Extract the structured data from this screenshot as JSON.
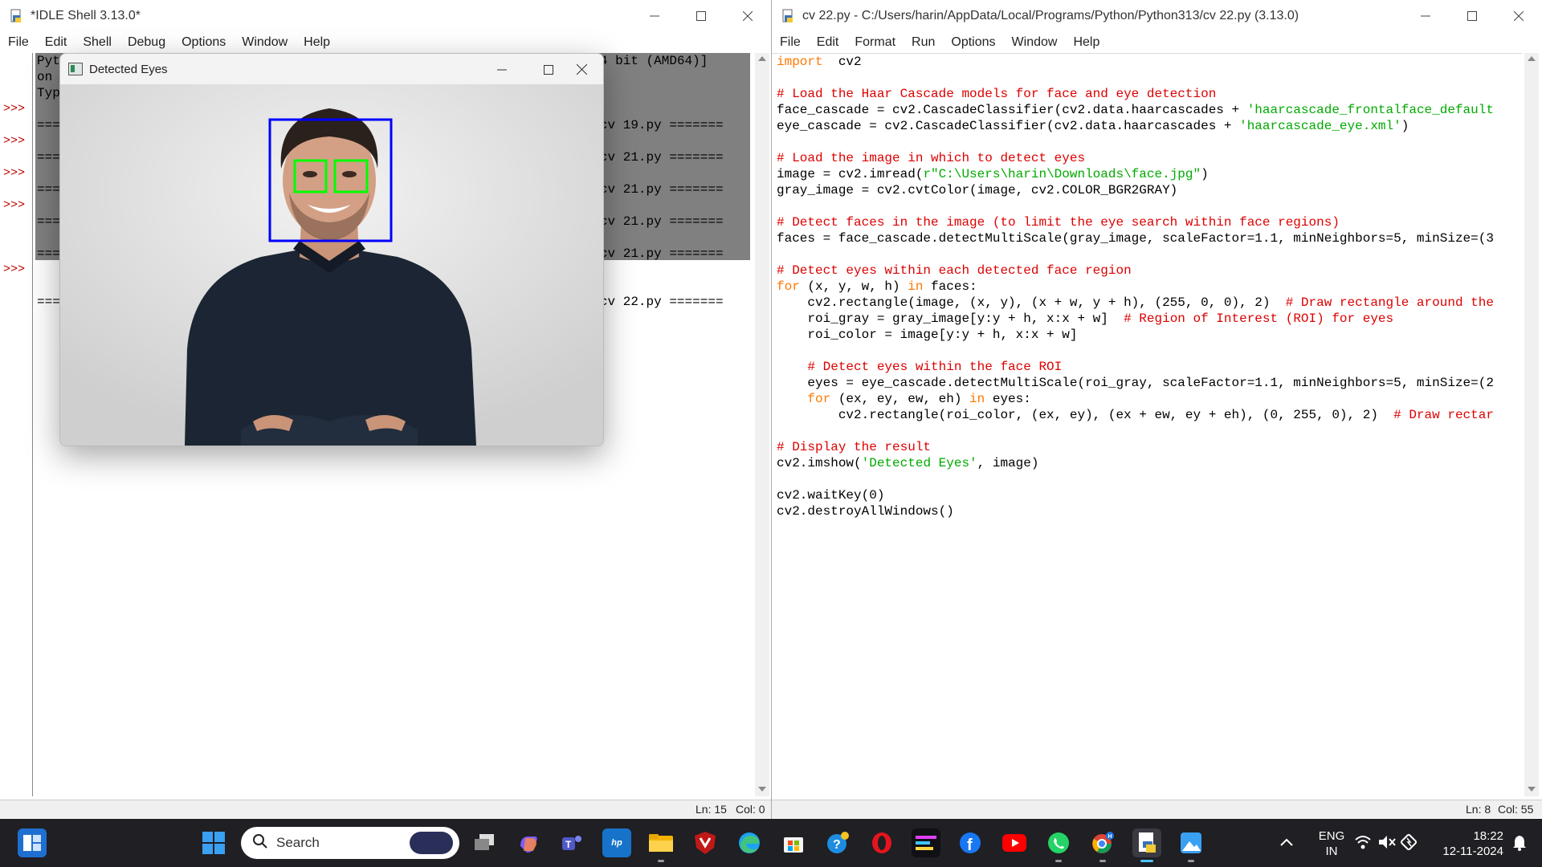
{
  "shell_window": {
    "title": "*IDLE Shell 3.13.0*",
    "menu": [
      "File",
      "Edit",
      "Shell",
      "Debug",
      "Options",
      "Window",
      "Help"
    ],
    "prompt": ">>>",
    "lines": [
      "Python 3.13.0 (tags/v3.13.0:60403a5, Oct  7 2024, 09:38:07) [MSC v.1941 64 bit (AMD64)]",
      "on win32",
      "Type \"help\", \"copyright\", \"credits\" or \"license()\" for more information.",
      "",
      "======== RESTART: C:/Users/harin/AppData/Local/Programs/Python/Python313/cv 19.py =======",
      "",
      "======== RESTART: C:/Users/harin/AppData/Local/Programs/Python/Python313/cv 21.py =======",
      "",
      "======== RESTART: C:/Users/harin/AppData/Local/Programs/Python/Python313/cv 21.py =======",
      "",
      "======== RESTART: C:/Users/harin/AppData/Local/Programs/Python/Python313/cv 21.py =======",
      "",
      "======== RESTART: C:/Users/harin/AppData/Local/Programs/Python/Python313/cv 21.py =======",
      "",
      "",
      "======== RESTART: C:/Users/harin/AppData/Local/Programs/Python/Python313/cv 22.py ======="
    ],
    "status": {
      "ln": "Ln: 15",
      "col": "Col: 0"
    }
  },
  "popup_window": {
    "title": "Detected Eyes"
  },
  "editor_window": {
    "title": "cv 22.py - C:/Users/harin/AppData/Local/Programs/Python/Python313/cv 22.py (3.13.0)",
    "menu": [
      "File",
      "Edit",
      "Format",
      "Run",
      "Options",
      "Window",
      "Help"
    ],
    "code": [
      [
        [
          "kw",
          "import"
        ],
        [
          "",
          "  cv2"
        ]
      ],
      [],
      [
        [
          "cm",
          "# Load the Haar Cascade models for face and eye detection"
        ]
      ],
      [
        [
          "",
          "face_cascade = cv2.CascadeClassifier(cv2.data.haarcascades + "
        ],
        [
          "st",
          "'haarcascade_frontalface_default"
        ]
      ],
      [
        [
          "",
          "eye_cascade = cv2.CascadeClassifier(cv2.data.haarcascades + "
        ],
        [
          "st",
          "'haarcascade_eye.xml'"
        ],
        [
          "",
          ")"
        ]
      ],
      [],
      [
        [
          "cm",
          "# Load the image in which to detect eyes"
        ]
      ],
      [
        [
          "",
          "image = cv2.imread("
        ],
        [
          "st",
          "r\"C:\\Users\\harin\\Downloads\\face.jpg\""
        ],
        [
          "",
          ")"
        ]
      ],
      [
        [
          "",
          "gray_image = cv2.cvtColor(image, cv2.COLOR_BGR2GRAY)"
        ]
      ],
      [],
      [
        [
          "cm",
          "# Detect faces in the image (to limit the eye search within face regions)"
        ]
      ],
      [
        [
          "",
          "faces = face_cascade.detectMultiScale(gray_image, scaleFactor=1.1, minNeighbors=5, minSize=(3"
        ]
      ],
      [],
      [
        [
          "cm",
          "# Detect eyes within each detected face region"
        ]
      ],
      [
        [
          "kw",
          "for"
        ],
        [
          "",
          " (x, y, w, h) "
        ],
        [
          "kw",
          "in"
        ],
        [
          "",
          " faces:"
        ]
      ],
      [
        [
          "",
          "    cv2.rectangle(image, (x, y), (x + w, y + h), (255, 0, 0), 2)  "
        ],
        [
          "cm",
          "# Draw rectangle around the"
        ]
      ],
      [
        [
          "",
          "    roi_gray = gray_image[y:y + h, x:x + w]  "
        ],
        [
          "cm",
          "# Region of Interest (ROI) for eyes"
        ]
      ],
      [
        [
          "",
          "    roi_color = image[y:y + h, x:x + w]"
        ]
      ],
      [],
      [
        [
          "cm",
          "    # Detect eyes within the face ROI"
        ]
      ],
      [
        [
          "",
          "    eyes = eye_cascade.detectMultiScale(roi_gray, scaleFactor=1.1, minNeighbors=5, minSize=(2"
        ]
      ],
      [
        [
          "kw",
          "    for"
        ],
        [
          "",
          " (ex, ey, ew, eh) "
        ],
        [
          "kw",
          "in"
        ],
        [
          "",
          " eyes:"
        ]
      ],
      [
        [
          "",
          "        cv2.rectangle(roi_color, (ex, ey), (ex + ew, ey + eh), (0, 255, 0), 2)  "
        ],
        [
          "cm",
          "# Draw rectar"
        ]
      ],
      [],
      [
        [
          "cm",
          "# Display the result"
        ]
      ],
      [
        [
          "",
          "cv2.imshow("
        ],
        [
          "st",
          "'Detected Eyes'"
        ],
        [
          "",
          ", image)"
        ]
      ],
      [],
      [
        [
          "",
          "cv2.waitKey(0)"
        ]
      ],
      [
        [
          "",
          "cv2.destroyAllWindows()"
        ]
      ]
    ],
    "status": {
      "ln": "Ln: 8",
      "col": "Col: 55"
    }
  },
  "taskbar": {
    "search_placeholder": "Search",
    "language": "ENG",
    "region": "IN",
    "time": "18:22",
    "date": "12-11-2024",
    "icons": [
      "start-icon",
      "taskview-icon",
      "copilot-icon",
      "teams-icon",
      "myhp-icon",
      "file-explorer-icon",
      "mcafee-icon",
      "edge-icon",
      "store-icon",
      "help-icon",
      "opera-icon",
      "idle-app-icon",
      "facebook-icon",
      "youtube-icon",
      "whatsapp-icon",
      "chrome-icon",
      "python-editor-icon",
      "photos-icon"
    ],
    "tray": [
      "chevron-up-icon",
      "wifi-icon",
      "mute-icon",
      "battery-icon",
      "notification-bell-icon"
    ]
  },
  "colors": {
    "keyword": "#ff7700",
    "comment": "#dd0000",
    "string": "#00aa00",
    "selection": "#808080",
    "prompt": "#c00000"
  }
}
